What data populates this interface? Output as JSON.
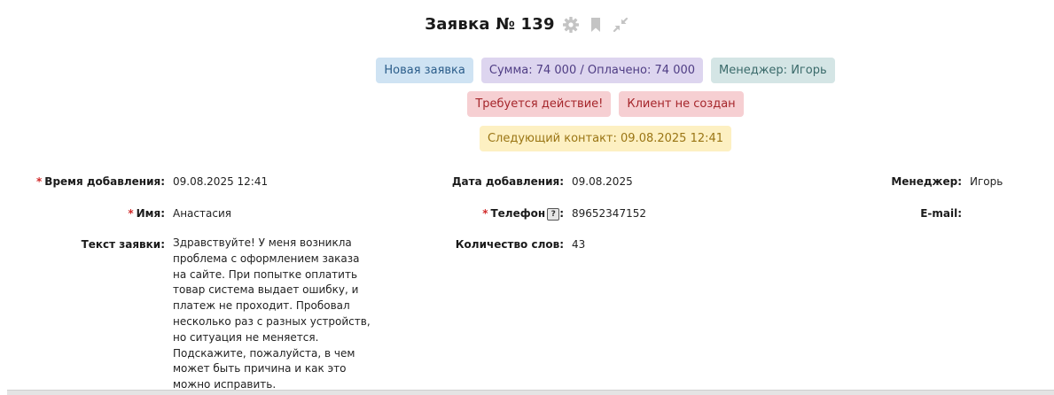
{
  "header": {
    "title": "Заявка № 139",
    "icons": [
      "gear-icon",
      "bookmark-icon",
      "collapse-icon"
    ]
  },
  "badges": {
    "status": "Новая заявка",
    "sum": "Сумма: 74 000 / Оплачено: 74 000",
    "manager": "Менеджер: Игорь",
    "action_required": "Требуется действие!",
    "client_not_created": "Клиент не создан",
    "next_contact": "Следующий контакт: 09.08.2025 12:41"
  },
  "fields": {
    "added_time": {
      "label": "Время добавления:",
      "value": "09.08.2025 12:41",
      "required": "*"
    },
    "added_date": {
      "label": "Дата добавления:",
      "value": "09.08.2025"
    },
    "manager": {
      "label": "Менеджер:",
      "value": "Игорь"
    },
    "name": {
      "label": "Имя:",
      "value": "Анастасия",
      "required": "*"
    },
    "phone": {
      "label": "Телефон",
      "value": "89652347152",
      "required": "*",
      "help": "?"
    },
    "email": {
      "label": "E-mail:",
      "value": ""
    },
    "request_text": {
      "label": "Текст заявки:",
      "value": "Здравствуйте! У меня возникла проблема с оформлением заказа на сайте. При попытке оплатить товар система выдает ошибку, и платеж не проходит. Пробовал несколько раз с разных устройств, но ситуация не меняется. Подскажите, пожалуйста, в чем может быть причина и как это можно исправить."
    },
    "word_count": {
      "label": "Количество слов:",
      "value": "43"
    }
  },
  "colors": {
    "blue_badge": "#cfe3f3",
    "purple_badge": "#ddd5ef",
    "teal_badge": "#d4e5e5",
    "red_badge": "#f6cfd2",
    "yellow_badge": "#fdf0c2",
    "required_mark": "#d12a2a"
  }
}
